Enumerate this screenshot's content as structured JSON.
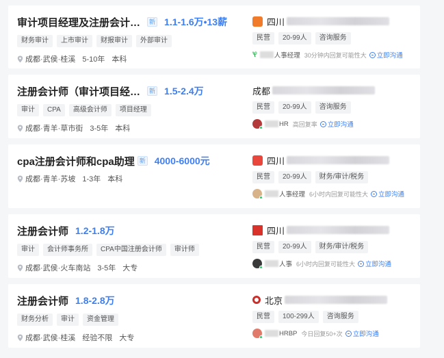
{
  "jobs": [
    {
      "title": "审计项目经理及注册会计…",
      "badge": "新",
      "salary": "1.1-1.6万•13薪",
      "tags": [
        "财务审计",
        "上市审计",
        "财报审计",
        "外部审计"
      ],
      "location": "成都·武侯·桂溪",
      "experience": "5-10年",
      "education": "本科",
      "company": {
        "name": "四川",
        "logo_text": "Logo",
        "logo_color": "#f07b2a",
        "tags": [
          "民营",
          "20-99人",
          "咨询服务"
        ]
      },
      "hr": {
        "name": "人事经理",
        "reply": "30分钟内回复可能性大",
        "chat": "立即沟通"
      }
    },
    {
      "title": "注册会计师（审计项目经…",
      "badge": "新",
      "salary": "1.5-2.4万",
      "tags": [
        "审计",
        "CPA",
        "高级会计师",
        "项目经理"
      ],
      "location": "成都·青羊·草市街",
      "experience": "3-5年",
      "education": "本科",
      "company": {
        "name": "成都",
        "logo_text": "",
        "logo_color": "",
        "tags": [
          "民营",
          "20-99人",
          "咨询服务"
        ]
      },
      "hr": {
        "name": "HR",
        "reply": "高回复率",
        "chat": "立即沟通"
      }
    },
    {
      "title": "cpa注册会计师和cpa助理",
      "badge": "新",
      "salary": "4000-6000元",
      "tags": [],
      "location": "成都·青羊·苏坡",
      "experience": "1-3年",
      "education": "本科",
      "company": {
        "name": "四川",
        "logo_text": "Logo",
        "logo_color": "#e9473c",
        "tags": [
          "民营",
          "20-99人",
          "财务/审计/税务"
        ]
      },
      "hr": {
        "name": "人事经理",
        "reply": "6小时内回复可能性大",
        "chat": "立即沟通"
      }
    },
    {
      "title": "注册会计师",
      "badge": "",
      "salary": "1.2-1.8万",
      "tags": [
        "审计",
        "会计师事务所",
        "CPA中国注册会计师",
        "审计师"
      ],
      "location": "成都·武侯·火车南站",
      "experience": "3-5年",
      "education": "大专",
      "company": {
        "name": "四川",
        "logo_text": "",
        "logo_color": "#d8322b",
        "tags": [
          "民营",
          "20-99人",
          "财务/审计/税务"
        ]
      },
      "hr": {
        "name": "人事",
        "reply": "6小时内回复可能性大",
        "chat": "立即沟通"
      }
    },
    {
      "title": "注册会计师",
      "badge": "",
      "salary": "1.8-2.8万",
      "tags": [
        "财务分析",
        "审计",
        "资金管理"
      ],
      "location": "成都·武侯·桂溪",
      "experience": "经验不限",
      "education": "大专",
      "company": {
        "name": "北京",
        "logo_text": "",
        "logo_color": "#c9302c",
        "tags": [
          "民营",
          "100-299人",
          "咨询服务"
        ]
      },
      "hr": {
        "name": "HRBP",
        "reply": "今日回复50+次",
        "chat": "立即沟通"
      }
    }
  ]
}
